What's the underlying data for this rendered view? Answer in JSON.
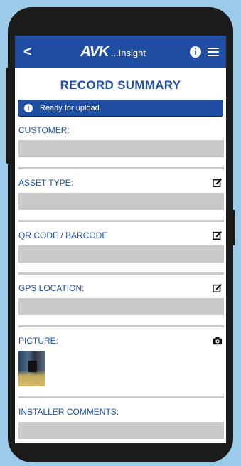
{
  "header": {
    "back_glyph": "<",
    "brand_logo": "AVK",
    "brand_tag": "...Insight",
    "info_glyph": "i"
  },
  "page_title": "RECORD SUMMARY",
  "banner": {
    "icon_glyph": "i",
    "text": "Ready for upload."
  },
  "sections": {
    "customer": {
      "label": "CUSTOMER:",
      "value": ""
    },
    "asset_type": {
      "label": "ASSET TYPE:",
      "value": ""
    },
    "qr_code": {
      "label": "QR CODE / BARCODE",
      "value": ""
    },
    "gps": {
      "label": "GPS LOCATION:",
      "value": ""
    },
    "picture": {
      "label": "PICTURE:"
    },
    "installer_comments": {
      "label": "INSTALLER COMMENTS:",
      "value": ""
    }
  },
  "colors": {
    "accent": "#1f4ea3",
    "field_bg": "#c9c9c9",
    "background": "#9ccbe9"
  }
}
